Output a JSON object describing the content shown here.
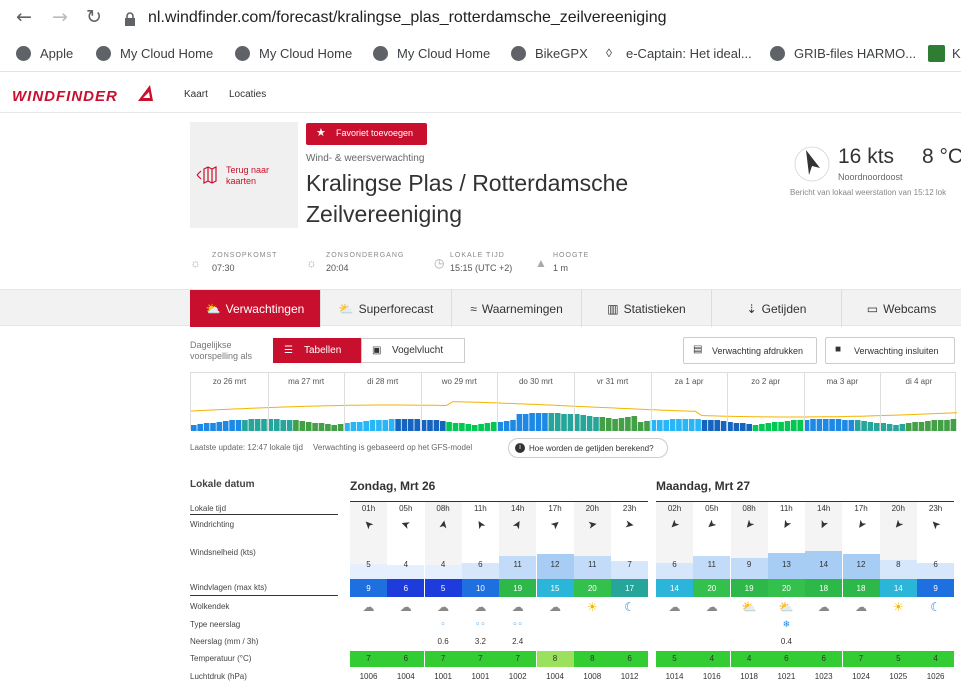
{
  "browser": {
    "url": "nl.windfinder.com/forecast/kralingse_plas_rotterdamsche_zeilvereeniging",
    "bookmarks": [
      "Apple",
      "My Cloud Home",
      "My Cloud Home",
      "My Cloud Home",
      "BikeGPX",
      "e-Captain: Het ideal...",
      "GRIB-files HARMO...",
      "K"
    ]
  },
  "site": {
    "logo": "WINDFINDER",
    "nav": [
      "Kaart",
      "Locaties"
    ]
  },
  "spot": {
    "back_label": "Terug naar kaarten",
    "favorite_label": "Favoriet toevoegen",
    "subtitle": "Wind- & weersverwachting",
    "title": "Kralingse Plas / Rotterdamsche Zeilvereeniging",
    "current_wind": "16 kts",
    "current_temp": "8 °C",
    "wind_direction": "Noordnoordoost",
    "report_note": "Bericht van lokaal weerstation van 15:12 lok"
  },
  "meta": [
    {
      "label": "ZONSOPKOMST",
      "value": "07:30"
    },
    {
      "label": "ZONSONDERGANG",
      "value": "20:04"
    },
    {
      "label": "LOKALE TIJD",
      "value": "15:15 (UTC +2)"
    },
    {
      "label": "HOOGTE",
      "value": "1 m"
    }
  ],
  "tabs": [
    "Verwachtingen",
    "Superforecast",
    "Waarnemingen",
    "Statistieken",
    "Getijden",
    "Webcams"
  ],
  "controls": {
    "daily_label": "Dagelijkse voorspelling als",
    "view_table": "Tabellen",
    "view_bird": "Vogelvlucht",
    "print_label": "Verwachting afdrukken",
    "embed_label": "Verwachting insluiten"
  },
  "overview_days": [
    "zo 26 mrt",
    "ma 27 mrt",
    "di 28 mrt",
    "wo 29 mrt",
    "do 30 mrt",
    "vr 31 mrt",
    "za 1 apr",
    "zo 2 apr",
    "ma 3 apr",
    "di 4 apr"
  ],
  "update_text": "Laatste update: 12:47 lokale tijd",
  "model_text": "Verwachting is gebaseerd op het GFS-model",
  "tide_question": "Hoe worden de getijden berekend?",
  "table": {
    "row_labels": [
      "Lokale datum",
      "Lokale tijd",
      "Windrichting",
      "Windsnelheid (kts)",
      "Windvlagen (max kts)",
      "Wolkendek",
      "Type neerslag",
      "Neerslag (mm / 3h)",
      "Temperatuur (°C)",
      "Luchtdruk (hPa)"
    ],
    "days": [
      {
        "title": "Zondag, Mrt 26",
        "hours": [
          "01h",
          "05h",
          "08h",
          "11h",
          "14h",
          "17h",
          "20h",
          "23h"
        ],
        "wind_dir_deg": [
          225,
          200,
          280,
          240,
          300,
          320,
          350,
          10
        ],
        "wind_speed": [
          "5",
          "4",
          "4",
          "6",
          "11",
          "12",
          "11",
          "7"
        ],
        "gusts": [
          "9",
          "6",
          "5",
          "10",
          "19",
          "15",
          "20",
          "17"
        ],
        "clouds": [
          "partly-cloudy-night-icon",
          "cloud-icon",
          "cloud-icon",
          "cloud-icon",
          "cloud-icon",
          "cloud-icon",
          "sun-icon",
          "moon-icon"
        ],
        "precip_type": [
          "",
          "",
          "rain-drop-icon",
          "rain-drops-icon",
          "rain-drops-icon",
          "",
          "",
          ""
        ],
        "precip": [
          "",
          "",
          "0.6",
          "3.2",
          "2.4",
          "",
          "",
          ""
        ],
        "temp": [
          "7",
          "6",
          "7",
          "7",
          "7",
          "8",
          "8",
          "6"
        ],
        "pressure": [
          "1006",
          "1004",
          "1001",
          "1001",
          "1002",
          "1004",
          "1008",
          "1012"
        ]
      },
      {
        "title": "Maandag, Mrt 27",
        "hours": [
          "02h",
          "05h",
          "08h",
          "11h",
          "14h",
          "17h",
          "20h",
          "23h"
        ],
        "wind_dir_deg": [
          135,
          140,
          130,
          120,
          115,
          125,
          130,
          225
        ],
        "wind_speed": [
          "6",
          "11",
          "9",
          "13",
          "14",
          "12",
          "8",
          "6"
        ],
        "gusts": [
          "14",
          "20",
          "19",
          "20",
          "18",
          "18",
          "14",
          "9"
        ],
        "clouds": [
          "cloud-icon",
          "partly-cloudy-night-icon",
          "sun-cloud-icon",
          "sun-cloud-icon",
          "cloud-icon",
          "cloud-icon",
          "sun-icon",
          "moon-icon"
        ],
        "precip_type": [
          "",
          "",
          "",
          "snow-icon",
          "",
          "",
          "",
          ""
        ],
        "precip": [
          "",
          "",
          "",
          "0.4",
          "",
          "",
          "",
          ""
        ],
        "temp": [
          "5",
          "4",
          "4",
          "6",
          "6",
          "7",
          "5",
          "4"
        ],
        "pressure": [
          "1014",
          "1016",
          "1018",
          "1021",
          "1023",
          "1024",
          "1025",
          "1026"
        ]
      }
    ]
  },
  "colors": {
    "brand_red": "#c8102e",
    "temp_green": "#33cc33",
    "temp_light": "#9be15d"
  }
}
